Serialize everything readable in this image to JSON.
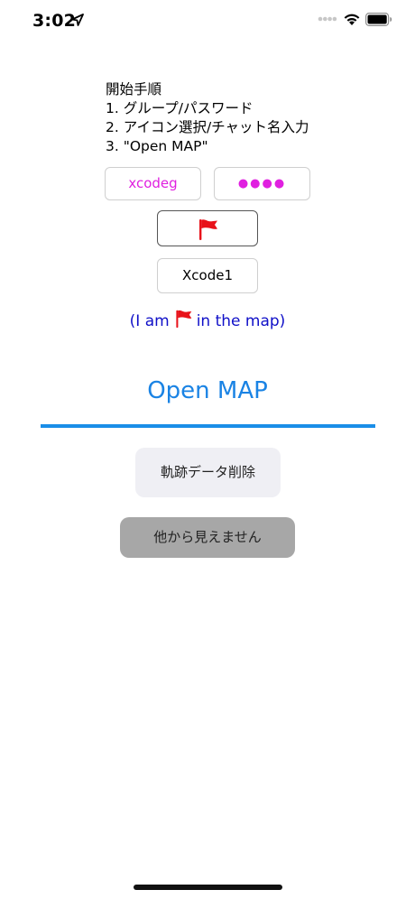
{
  "status_bar": {
    "time": "3:02",
    "icons": [
      "location-arrow-icon",
      "signal-dots-icon",
      "wifi-icon",
      "battery-icon"
    ]
  },
  "instructions": {
    "title": "開始手順",
    "steps": [
      "1. グループ/パスワード",
      "2. アイコン選択/チャット名入力",
      "3. \"Open MAP\""
    ]
  },
  "form": {
    "group_value": "xcodeg",
    "password_value": "●●●●",
    "selected_icon": "red-flag-icon",
    "chat_name_value": "Xcode1"
  },
  "status_line": {
    "prefix": "(I am",
    "suffix": "in the map)"
  },
  "actions": {
    "open_map": "Open MAP",
    "delete_track": "軌跡データ削除",
    "hidden_toggle": "他から見えません"
  },
  "colors": {
    "accent_magenta": "#e020e0",
    "status_blue": "#1010c8",
    "open_map_blue": "#1a83e4",
    "flag_red": "#e8121a"
  }
}
